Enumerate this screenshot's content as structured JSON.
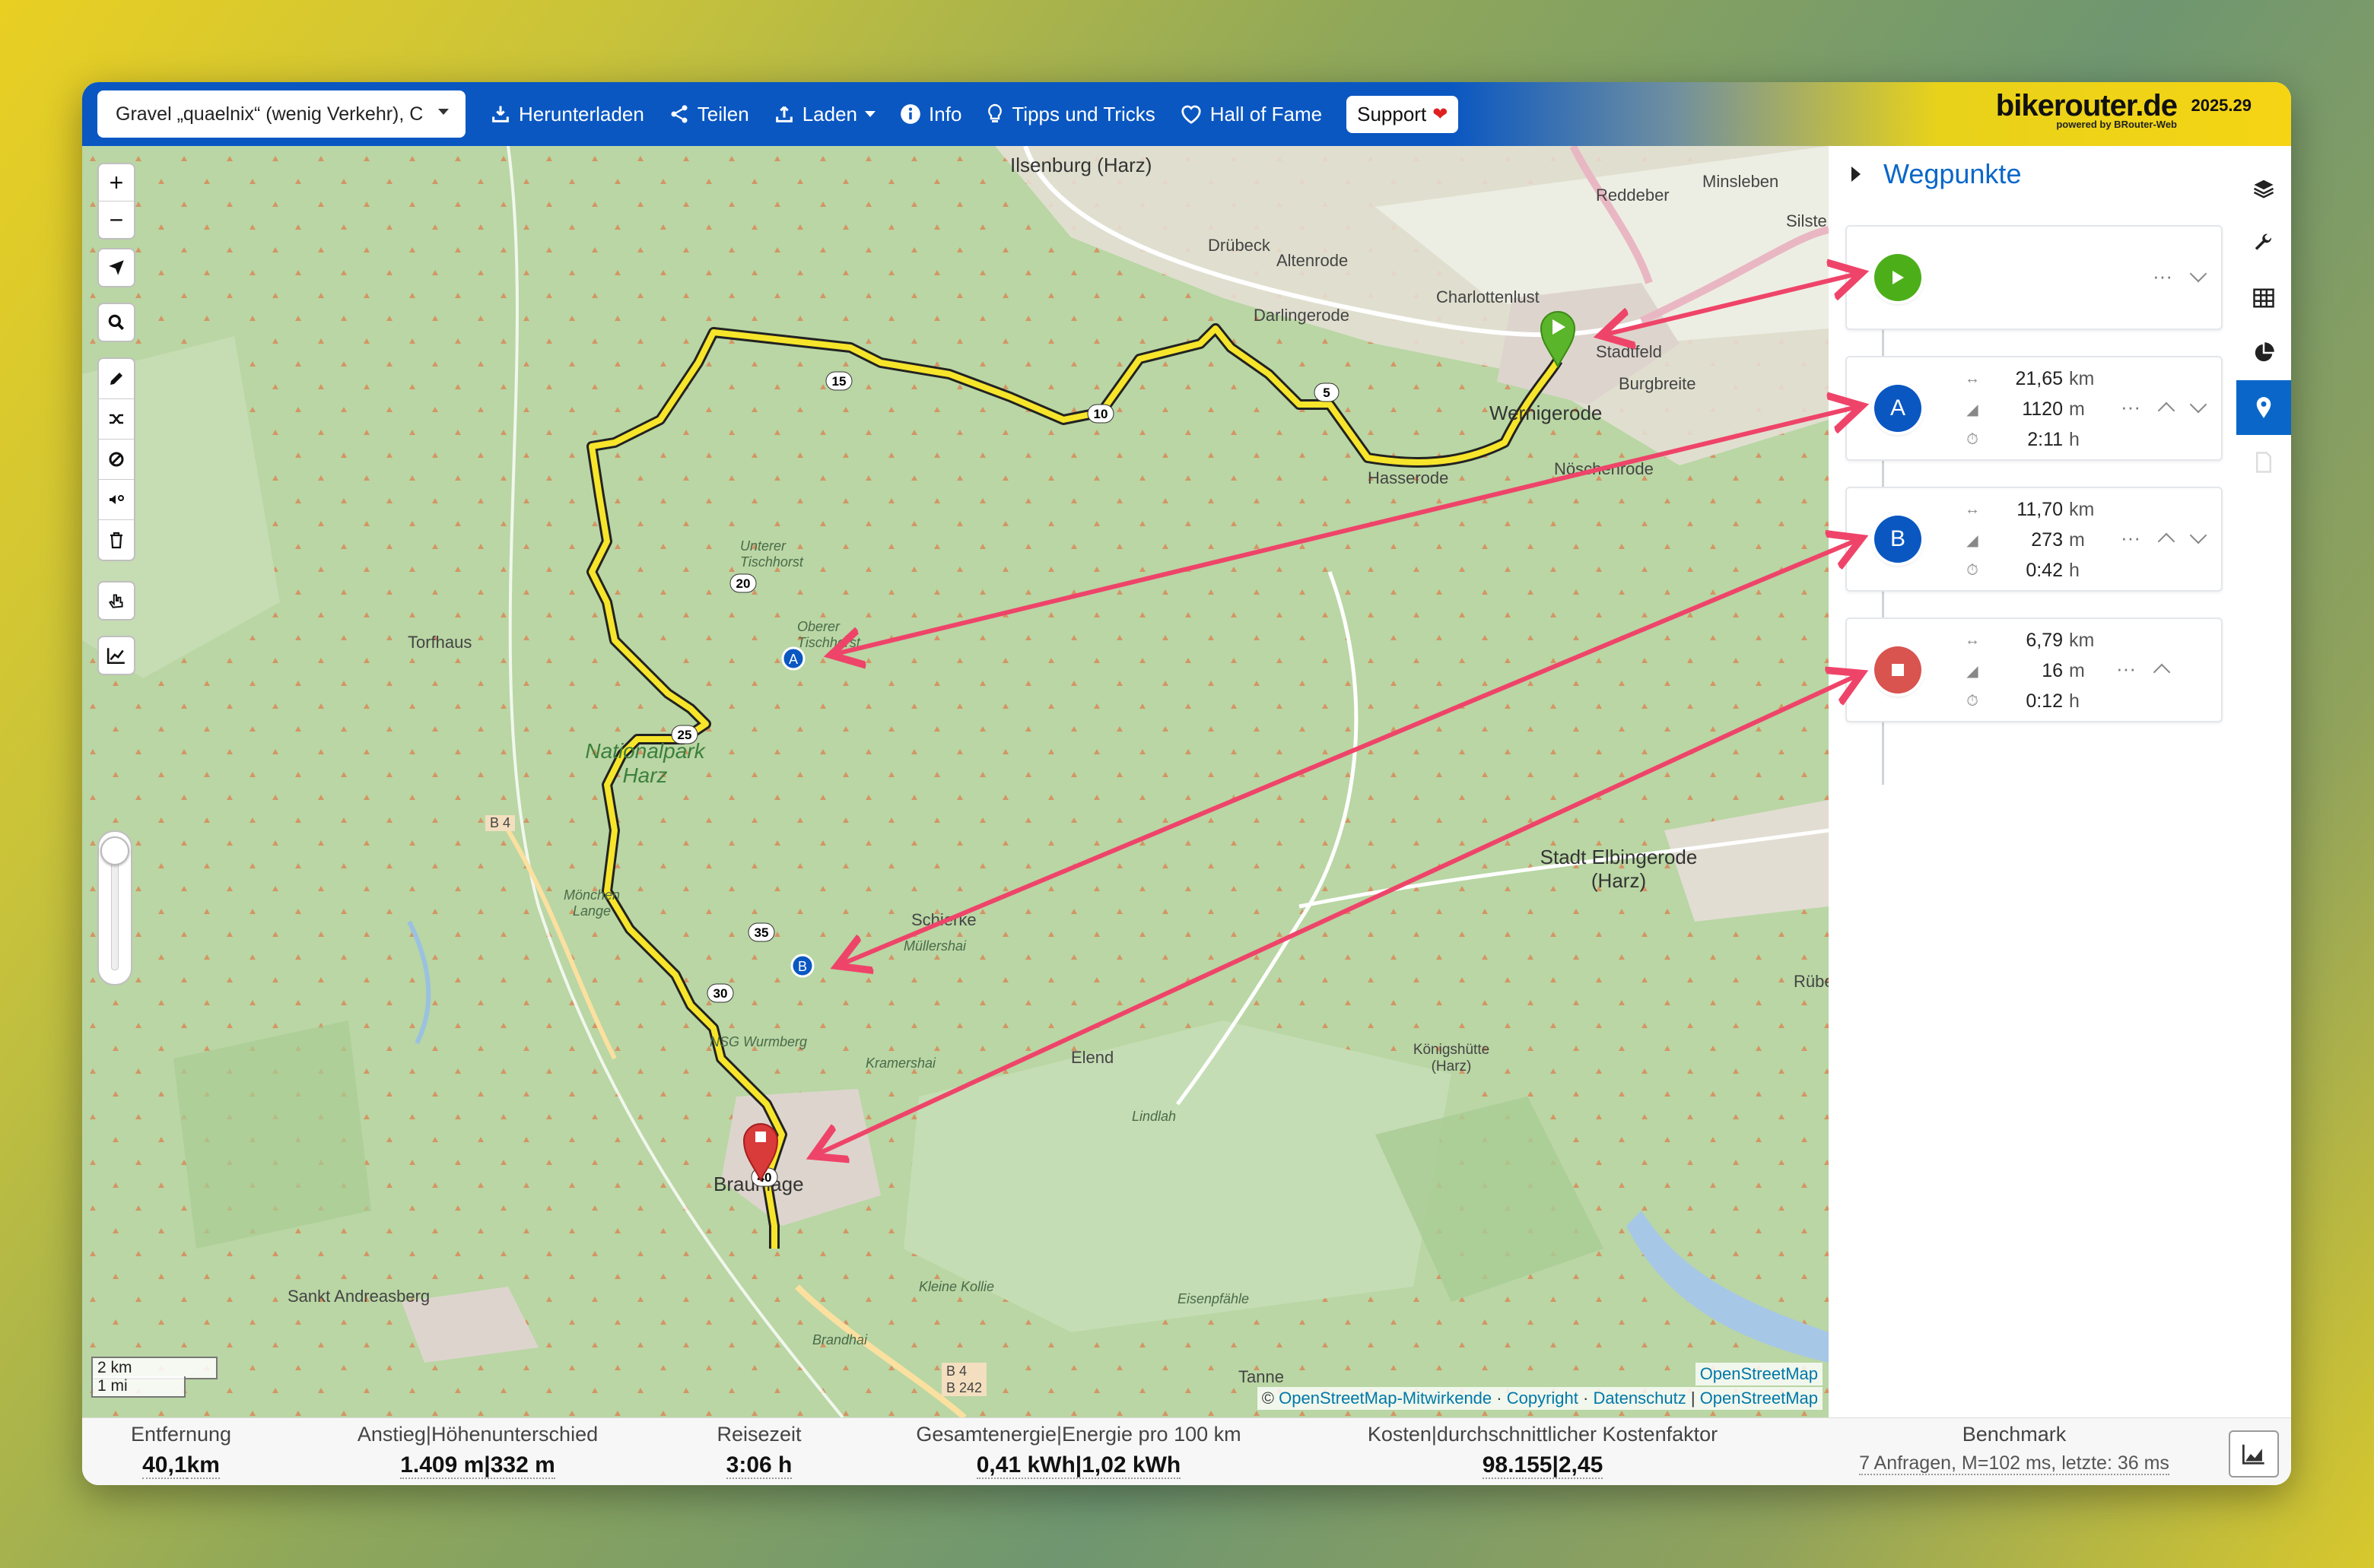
{
  "topbar": {
    "profile": "Gravel „quaelnix“ (wenig Verkehr), C",
    "download": "Herunterladen",
    "share": "Teilen",
    "load": "Laden",
    "info": "Info",
    "tips": "Tipps und Tricks",
    "hall_of_fame": "Hall of Fame",
    "support": "Support",
    "brand": "bikerouter.de",
    "brand_sub": "powered by BRouter-Web",
    "version": "2025.29"
  },
  "map": {
    "labels": {
      "ilsenburg": "Ilsenburg (Harz)",
      "drubeck": "Drübeck",
      "altenrode": "Altenrode",
      "darlingerode": "Darlingerode",
      "charlottenlust": "Charlottenlust",
      "reddeber": "Reddeber",
      "minsleben": "Minsleben",
      "silstedt": "Silste",
      "stadtfeld": "Stadtfeld",
      "burgbreite": "Burgbreite",
      "wernigerode": "Wernigerode",
      "hasserode": "Hasserode",
      "noschenrode": "Nöschenrode",
      "torfhaus": "Torfhaus",
      "nationalpark": "Nationalpark Harz",
      "b4": "B 4",
      "monchen": "Mönchen Lange",
      "schierke": "Schierke",
      "mullershai": "Müllershai",
      "stadt_elbingerode": "Stadt Elbingerode (Harz)",
      "rubeland": "Rübeland",
      "elend": "Elend",
      "kramershai": "Kramershai",
      "lindlah": "Lindlah",
      "konigshutte": "Königshütte (Harz)",
      "braunlage": "Braunlage",
      "sankt_andreasberg": "Sankt Andreasberg",
      "kleine_kollie": "Kleine Kollie",
      "eisenpfahle": "Eisenpfähle",
      "brandhai": "Brandhai",
      "tanne": "Tanne",
      "b4b242": "B 4\nB 242",
      "nsg": "NSG Wurmberg",
      "unterer": "Unterer Tischhorst",
      "oberer": "Oberer Tischhorst"
    },
    "km_markers": [
      "5",
      "10",
      "15",
      "20",
      "25",
      "30",
      "35",
      "40"
    ],
    "waypoint_markers": [
      "A",
      "B"
    ],
    "scale_km": "2 km",
    "scale_mi": "1 mi",
    "attribution_top": "OpenStreetMap",
    "attribution_prefix": "©",
    "attribution_contrib": "OpenStreetMap-Mitwirkende",
    "attribution_copyright": "Copyright",
    "attribution_privacy": "Datenschutz",
    "attribution_osm": "OpenStreetMap"
  },
  "panel": {
    "title": "Wegpunkte",
    "start_dots": "···",
    "waypoints": [
      {
        "label": "A",
        "dist": "21,65",
        "dist_unit": "km",
        "ascent": "1120",
        "ascent_unit": "m",
        "time": "2:11",
        "time_unit": "h"
      },
      {
        "label": "B",
        "dist": "11,70",
        "dist_unit": "km",
        "ascent": "273",
        "ascent_unit": "m",
        "time": "0:42",
        "time_unit": "h"
      },
      {
        "label": "",
        "dist": "6,79",
        "dist_unit": "km",
        "ascent": "16",
        "ascent_unit": "m",
        "time": "0:12",
        "time_unit": "h"
      }
    ],
    "dots": "···"
  },
  "bottom": {
    "distance_label": "Entfernung",
    "distance_value": "40,1",
    "distance_unit": "km",
    "ascent_label": "Anstieg|Höhenunterschied",
    "ascent_value": "1.409 m|332 m",
    "time_label": "Reisezeit",
    "time_value": "3:06 h",
    "energy_label": "Gesamtenergie|Energie pro 100 km",
    "energy_value": "0,41 kWh|1,02 kWh",
    "cost_label": "Kosten|durchschnittlicher Kostenfaktor",
    "cost_value": "98.155|2,45",
    "bench_label": "Benchmark",
    "bench_value": "7 Anfragen, M=102 ms, letzte: 36 ms"
  },
  "colors": {
    "brand_blue": "#0a57c2",
    "start_green": "#4caf1a",
    "waypoint_blue": "#0a57c2",
    "end_red": "#d9534f",
    "route_yellow": "#f6e52a",
    "arrow_pink": "#ef4469"
  }
}
